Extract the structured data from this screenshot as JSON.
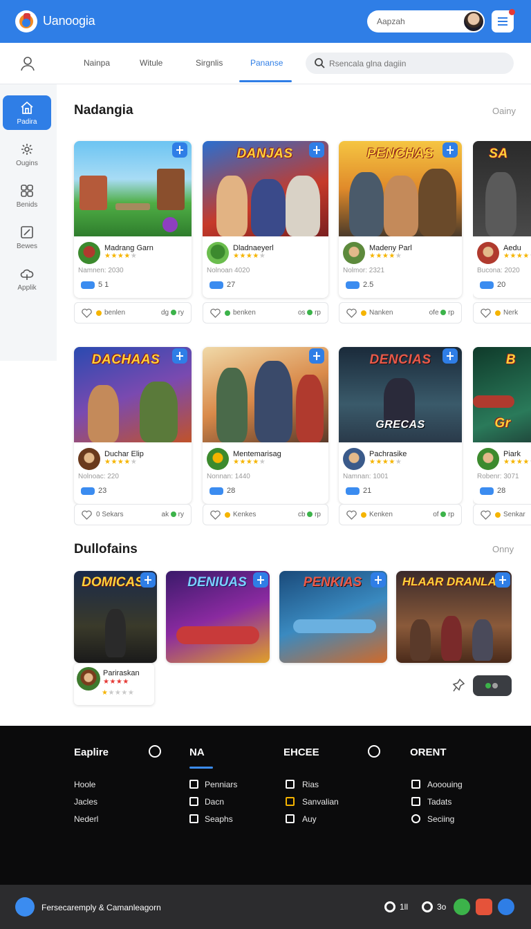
{
  "header": {
    "app_title": "Uanoogia",
    "search_value": "Aapzah"
  },
  "nav": {
    "tabs": [
      "Nainpa",
      "Witule",
      "Sirgnlis",
      "Pananse"
    ],
    "active_tab": "Pananse",
    "search_placeholder": "Rsencala glna dagiin"
  },
  "sidebar": {
    "items": [
      {
        "label": "Padira",
        "icon": "home-icon",
        "active": true
      },
      {
        "label": "Ougins",
        "icon": "gear-icon",
        "active": false
      },
      {
        "label": "Benids",
        "icon": "apps-icon",
        "active": false
      },
      {
        "label": "Bewes",
        "icon": "edit-icon",
        "active": false
      },
      {
        "label": "Applik",
        "icon": "cloud-icon",
        "active": false
      }
    ]
  },
  "section1": {
    "title": "Nadangia",
    "link": "Oainy"
  },
  "row1": [
    {
      "art_title": "",
      "name": "Madrang Garn",
      "meta": "Namnen: 2030",
      "count": "5 1",
      "action": "benlen",
      "right": "dg",
      "right_suffix": "ry"
    },
    {
      "art_title": "DANJAS",
      "name": "Dladnaeyerl",
      "meta": "Nolnoan 4020",
      "count": "27",
      "action": "benken",
      "right": "os",
      "right_suffix": "rp"
    },
    {
      "art_title": "PENCHAS",
      "name": "Madeny Parl",
      "meta": "Nolmor: 2321",
      "count": "2.5",
      "action": "Nanken",
      "right": "ofe",
      "right_suffix": "rp"
    },
    {
      "art_title": "SA",
      "name": "Aedu",
      "meta": "Bucona: 2020",
      "count": "20",
      "action": "Nerk",
      "right": "",
      "right_suffix": ""
    }
  ],
  "row2": [
    {
      "art_title": "DACHAAS",
      "name": "Duchar Elip",
      "meta": "Nolnoac: 220",
      "count": "23",
      "action": "0 Sekars",
      "right": "ak",
      "right_suffix": "ry"
    },
    {
      "art_title": "",
      "name": "Mentemarisag",
      "meta": "Nonnan: 1440",
      "count": "28",
      "action": "Kenkes",
      "right": "cb",
      "right_suffix": "rp"
    },
    {
      "art_title": "DENCIAS",
      "sub_title": "GRECAS",
      "name": "Pachrasike",
      "meta": "Namnan: 1001",
      "count": "21",
      "action": "Kenken",
      "right": "of",
      "right_suffix": "rp"
    },
    {
      "art_title": "B",
      "sub_title": "Gr",
      "name": "Piark",
      "meta": "Robenr: 3071",
      "count": "28",
      "action": "Senkar",
      "right": "",
      "right_suffix": ""
    }
  ],
  "section2": {
    "title": "Dullofains",
    "link": "Onny"
  },
  "row3": [
    {
      "art_title": "DOMICAS"
    },
    {
      "art_title": "DENIUAS"
    },
    {
      "art_title": "PENKIAS"
    },
    {
      "art_title": "HLAAR DRANLAS"
    }
  ],
  "mini_card": {
    "name": "Pariraskan"
  },
  "footer": {
    "cols": [
      {
        "title": "Eaplire",
        "links": [
          "Hoole",
          "Jacles",
          "Nederl"
        ]
      },
      {
        "title": "NA",
        "links": [
          "Penniars",
          "Dacn",
          "Seaphs"
        ]
      },
      {
        "title": "EHCEE",
        "links": [
          "Rias",
          "Sanvalian",
          "Auy"
        ]
      },
      {
        "title": "ORENT",
        "links": [
          "Aooouing",
          "Tadats",
          "Seciing"
        ]
      }
    ],
    "bottom_text": "Fersecaremply & Camanleagorn",
    "bottom_item1": "1ll",
    "bottom_item2": "3o"
  },
  "colors": {
    "brand": "#2f7ee6",
    "footer_bg": "#0b0b0c",
    "star": "#f5b400"
  }
}
